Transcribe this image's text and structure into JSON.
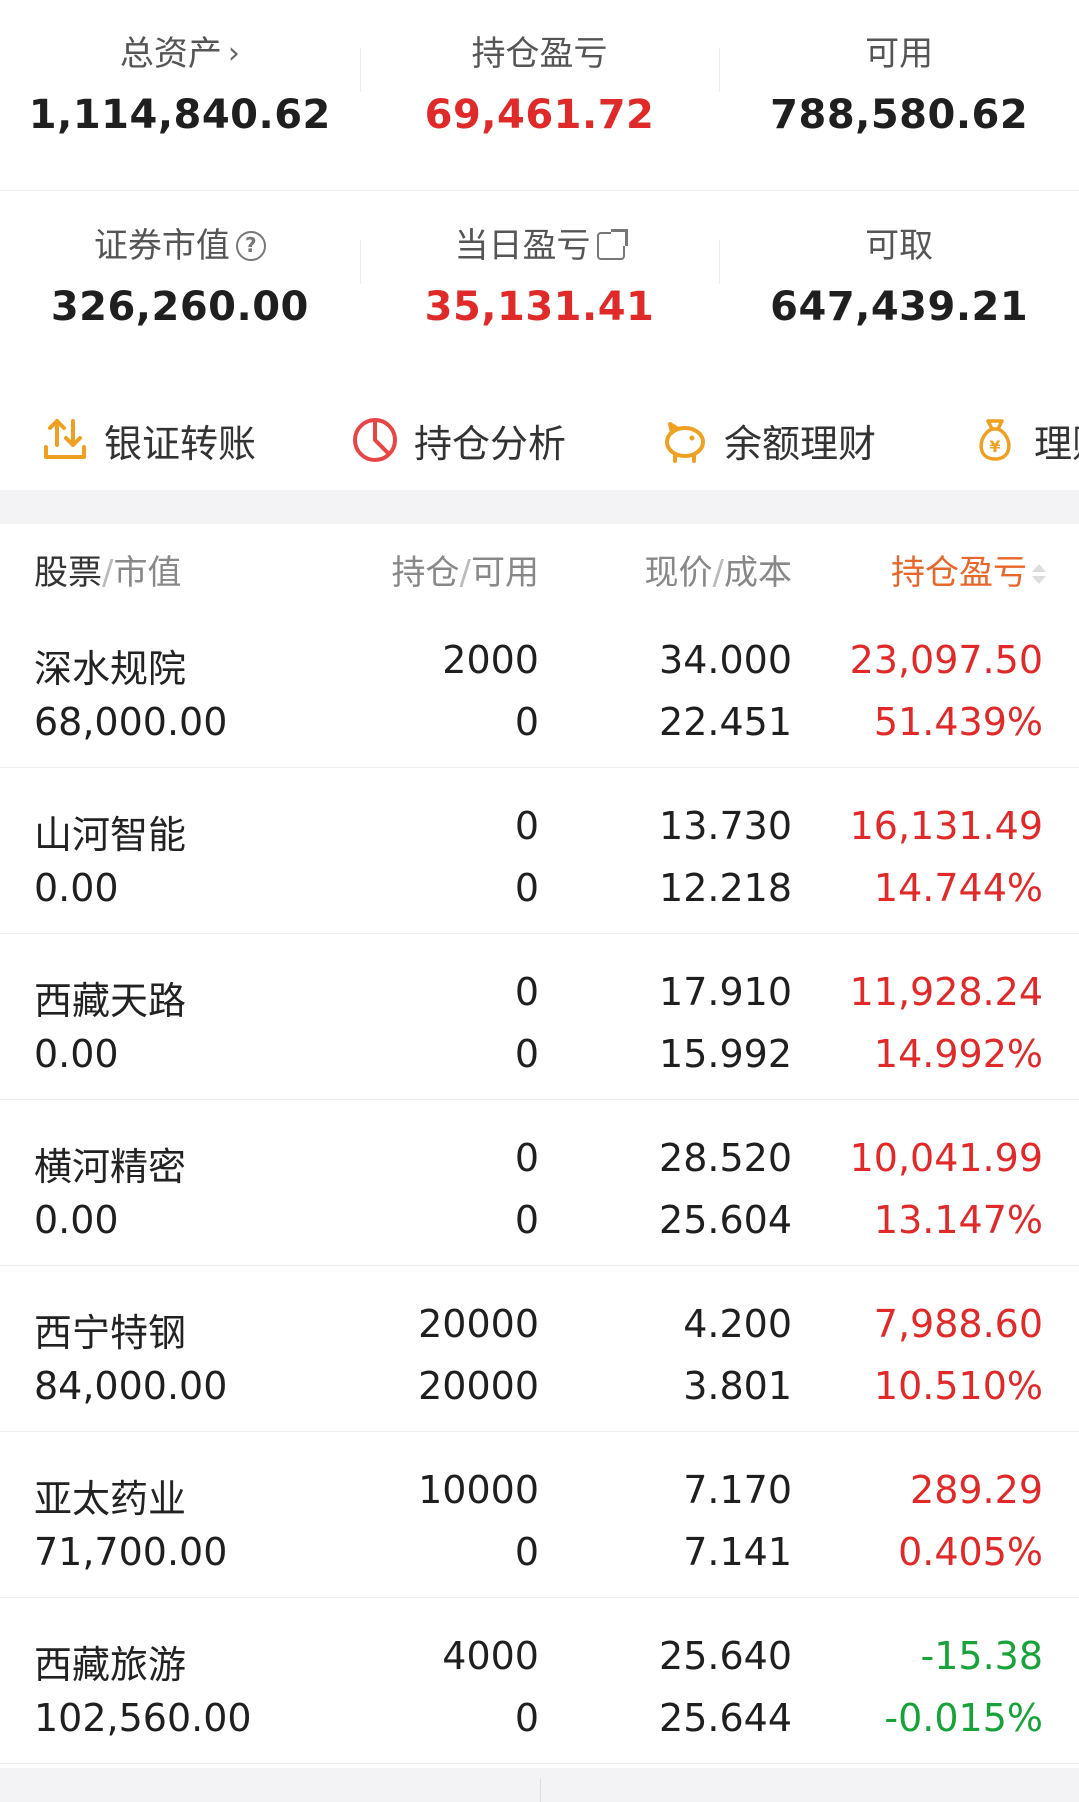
{
  "summary": {
    "total_assets": {
      "label": "总资产",
      "value": "1,114,840.62"
    },
    "position_pl": {
      "label": "持仓盈亏",
      "value": "69,461.72"
    },
    "available": {
      "label": "可用",
      "value": "788,580.62"
    },
    "securities_value": {
      "label": "证券市值",
      "value": "326,260.00"
    },
    "daily_pl": {
      "label": "当日盈亏",
      "value": "35,131.41"
    },
    "withdrawable": {
      "label": "可取",
      "value": "647,439.21"
    }
  },
  "actions": [
    {
      "label": "银证转账",
      "icon": "transfer-icon"
    },
    {
      "label": "持仓分析",
      "icon": "pie-chart-icon"
    },
    {
      "label": "余额理财",
      "icon": "piggy-bank-icon"
    },
    {
      "label": "理财",
      "icon": "money-bag-icon"
    }
  ],
  "table": {
    "headers": {
      "stock": "股票",
      "market_value": "市值",
      "position": "持仓",
      "available": "可用",
      "price": "现价",
      "cost": "成本",
      "pl": "持仓盈亏"
    },
    "rows": [
      {
        "name": "深水规院",
        "market_value": "68,000.00",
        "position": "2000",
        "available": "0",
        "price": "34.000",
        "cost": "22.451",
        "pl": "23,097.50",
        "pct": "51.439%",
        "trend": "up"
      },
      {
        "name": "山河智能",
        "market_value": "0.00",
        "position": "0",
        "available": "0",
        "price": "13.730",
        "cost": "12.218",
        "pl": "16,131.49",
        "pct": "14.744%",
        "trend": "up"
      },
      {
        "name": "西藏天路",
        "market_value": "0.00",
        "position": "0",
        "available": "0",
        "price": "17.910",
        "cost": "15.992",
        "pl": "11,928.24",
        "pct": "14.992%",
        "trend": "up"
      },
      {
        "name": "横河精密",
        "market_value": "0.00",
        "position": "0",
        "available": "0",
        "price": "28.520",
        "cost": "25.604",
        "pl": "10,041.99",
        "pct": "13.147%",
        "trend": "up"
      },
      {
        "name": "西宁特钢",
        "market_value": "84,000.00",
        "position": "20000",
        "available": "20000",
        "price": "4.200",
        "cost": "3.801",
        "pl": "7,988.60",
        "pct": "10.510%",
        "trend": "up"
      },
      {
        "name": "亚太药业",
        "market_value": "71,700.00",
        "position": "10000",
        "available": "0",
        "price": "7.170",
        "cost": "7.141",
        "pl": "289.29",
        "pct": "0.405%",
        "trend": "up"
      },
      {
        "name": "西藏旅游",
        "market_value": "102,560.00",
        "position": "4000",
        "available": "0",
        "price": "25.640",
        "cost": "25.644",
        "pl": "-15.38",
        "pct": "-0.015%",
        "trend": "down"
      }
    ]
  },
  "colors": {
    "up": "#e02a2a",
    "down": "#18a33a",
    "accent": "#e8662a",
    "icon_orange": "#f0a020"
  }
}
